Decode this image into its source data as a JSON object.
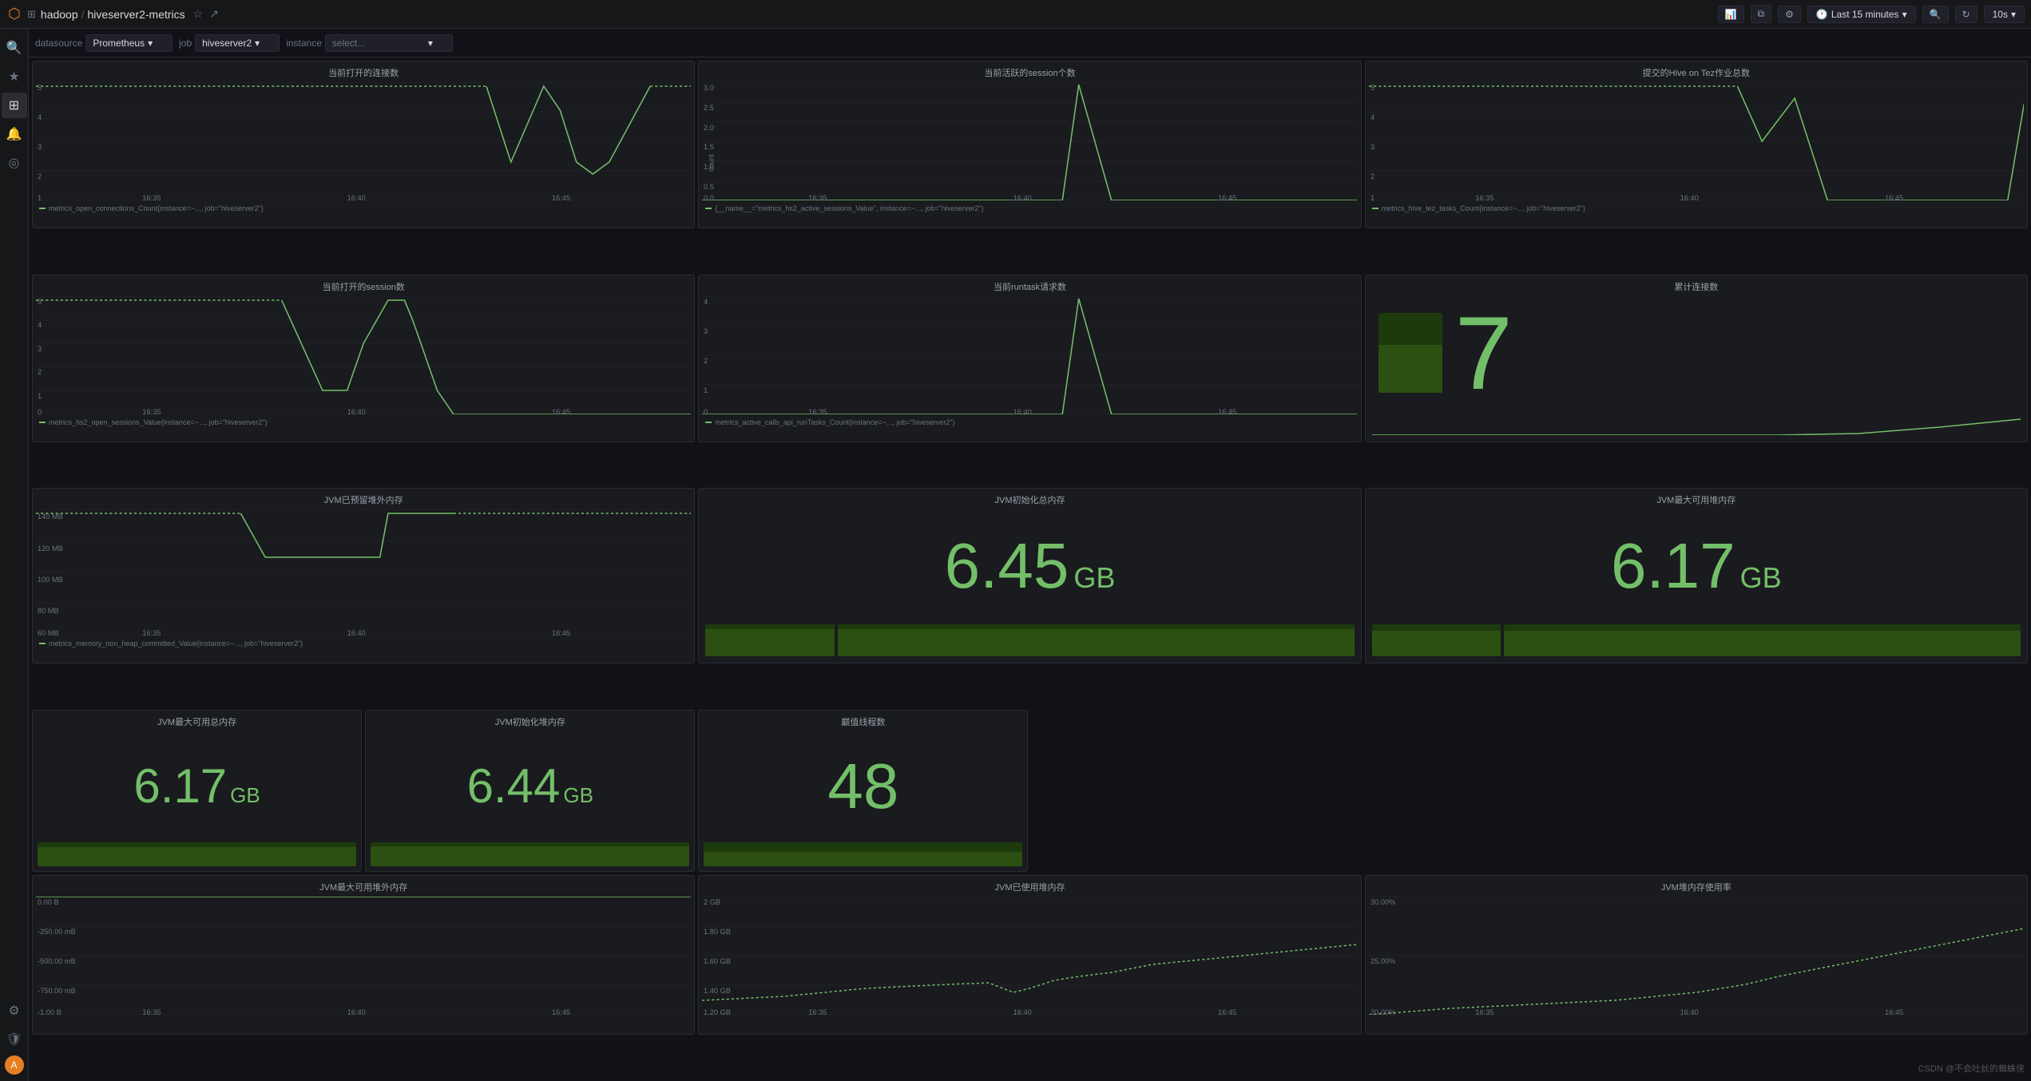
{
  "app": {
    "logo": "⬡",
    "breadcrumb": {
      "root": "hadoop",
      "separator": "/",
      "page": "hiveserver2-metrics"
    },
    "topbar": {
      "share_icon": "↗",
      "settings_icon": "⚙",
      "star_icon": "★",
      "time_range": "Last 15 minutes",
      "refresh": "10s",
      "zoom_in": "🔍",
      "refresh_icon": "↻"
    }
  },
  "filters": {
    "datasource_label": "datasource",
    "datasource_value": "Prometheus",
    "job_label": "job",
    "job_value": "hiveserver2",
    "instance_label": "instance",
    "instance_value": ""
  },
  "sidebar": {
    "items": [
      {
        "name": "search",
        "icon": "🔍"
      },
      {
        "name": "star",
        "icon": "★"
      },
      {
        "name": "apps",
        "icon": "⊞"
      },
      {
        "name": "alert",
        "icon": "🔔"
      },
      {
        "name": "explore",
        "icon": "◎"
      }
    ],
    "bottom": [
      {
        "name": "settings",
        "icon": "⚙"
      },
      {
        "name": "shield",
        "icon": "🛡"
      },
      {
        "name": "user",
        "icon": "👤"
      }
    ]
  },
  "panels": {
    "row1": [
      {
        "id": "open-connections",
        "title": "当前打开的连接数",
        "type": "graph",
        "ymax": 5,
        "ymin": 0,
        "yticks": [
          "5",
          "4",
          "3",
          "2",
          "1"
        ],
        "xticks": [
          "16:35",
          "16:40",
          "16:45"
        ],
        "legend": "metrics_open_connections_Count{instance=~..., job=\"hiveserver2\")"
      },
      {
        "id": "active-sessions",
        "title": "当前活跃的session个数",
        "type": "graph",
        "ymax": 3.0,
        "ymin": 0,
        "yticks": [
          "3.0",
          "2.5",
          "2.0",
          "1.5",
          "1.0",
          "0.5",
          "0.0"
        ],
        "ytick_label": "count",
        "xticks": [
          "16:35",
          "16:40",
          "16:45"
        ],
        "legend": "{__name__=\"metrics_hs2_active_sessions_Value\", instance=~..., job=\"hiveserver2\")"
      },
      {
        "id": "hive-tez-tasks",
        "title": "提交的Hive on Tez作业总数",
        "type": "graph",
        "ymax": 5,
        "ymin": 0,
        "yticks": [
          "5",
          "4",
          "3",
          "2",
          "1"
        ],
        "xticks": [
          "16:35",
          "16:40",
          "16:45"
        ],
        "legend": "metrics_hive_tez_tasks_Count{instance=~..., job=\"hiveserver2\")"
      }
    ],
    "row2": [
      {
        "id": "open-sessions",
        "title": "当前打开的session数",
        "type": "graph",
        "ymax": 5,
        "ymin": 0,
        "yticks": [
          "5",
          "4",
          "3",
          "2",
          "1",
          "0"
        ],
        "xticks": [
          "16:35",
          "16:40",
          "16:45"
        ],
        "legend": "metrics_hs2_open_sessions_Value{instance=~..., job=\"hiveserver2\")"
      },
      {
        "id": "runtask-requests",
        "title": "当前runtask请求数",
        "type": "graph",
        "ymax": 4,
        "ymin": 0,
        "yticks": [
          "4",
          "3",
          "2",
          "1",
          "0"
        ],
        "xticks": [
          "16:35",
          "16:40",
          "16:45"
        ],
        "legend": "metrics_active_calls_api_runTasks_Count{instance=~..., job=\"hiveserver2\")"
      },
      {
        "id": "cumulative-connections",
        "title": "累计连接数",
        "type": "stat",
        "value": "7",
        "color": "#73bf69"
      }
    ],
    "row3": [
      {
        "id": "non-heap-committed",
        "title": "JVM已预留堆外内存",
        "type": "graph",
        "ymax": 140,
        "ymin": 60,
        "yticks": [
          "140 MB",
          "120 MB",
          "100 MB",
          "80 MB",
          "60 MB"
        ],
        "xticks": [
          "16:35",
          "16:40",
          "16:45"
        ],
        "legend": "metrics_memory_non_heap_committed_Value{instance=~..., job=\"hiveserver2\")"
      },
      {
        "id": "init-heap-total",
        "title": "JVM初始化总内存",
        "type": "bigstat",
        "value": "6.45",
        "unit": "GB",
        "bar_pct": 85
      },
      {
        "id": "max-heap-used",
        "title": "JVM最大可用堆内存",
        "type": "bigstat",
        "value": "6.17",
        "unit": "GB",
        "bar_pct": 80
      },
      {
        "id": "max-total-memory",
        "title": "JVM最大可用总内存",
        "type": "bigstat",
        "value": "6.17",
        "unit": "GB",
        "bar_pct": 80
      },
      {
        "id": "init-heap-memory",
        "title": "JVM初始化堆内存",
        "type": "bigstat",
        "value": "6.44",
        "unit": "GB",
        "bar_pct": 84
      },
      {
        "id": "thread-count",
        "title": "巅值线程数",
        "type": "bigstat",
        "value": "48",
        "unit": "",
        "bar_pct": 60
      }
    ],
    "row4": [
      {
        "id": "max-off-heap",
        "title": "JVM最大可用堆外内存",
        "type": "graph",
        "ymax": 0,
        "ymin": -1000,
        "yticks": [
          "0.00 B",
          "-250.00 mB",
          "-500.00 mB",
          "-750.00 mB",
          "-1.00 B"
        ],
        "xticks": [
          "16:35",
          "16:40",
          "16:45"
        ]
      },
      {
        "id": "heap-used",
        "title": "JVM已使用堆内存",
        "type": "graph",
        "ymax": 2,
        "ymin": 1.2,
        "yticks": [
          "2 GB",
          "1.80 GB",
          "1.60 GB",
          "1.40 GB",
          "1.20 GB"
        ],
        "xticks": [
          "16:35",
          "16:40",
          "16:45"
        ]
      },
      {
        "id": "heap-usage-rate",
        "title": "JVM堆内存使用率",
        "type": "graph",
        "ymax": 30,
        "ymin": 20,
        "yticks": [
          "30.00%",
          "25.00%",
          "20.00%"
        ],
        "xticks": [
          "16:35",
          "16:40",
          "16:45"
        ]
      }
    ]
  },
  "watermark": "CSDN @不会吐丝的蜘蛛侠"
}
